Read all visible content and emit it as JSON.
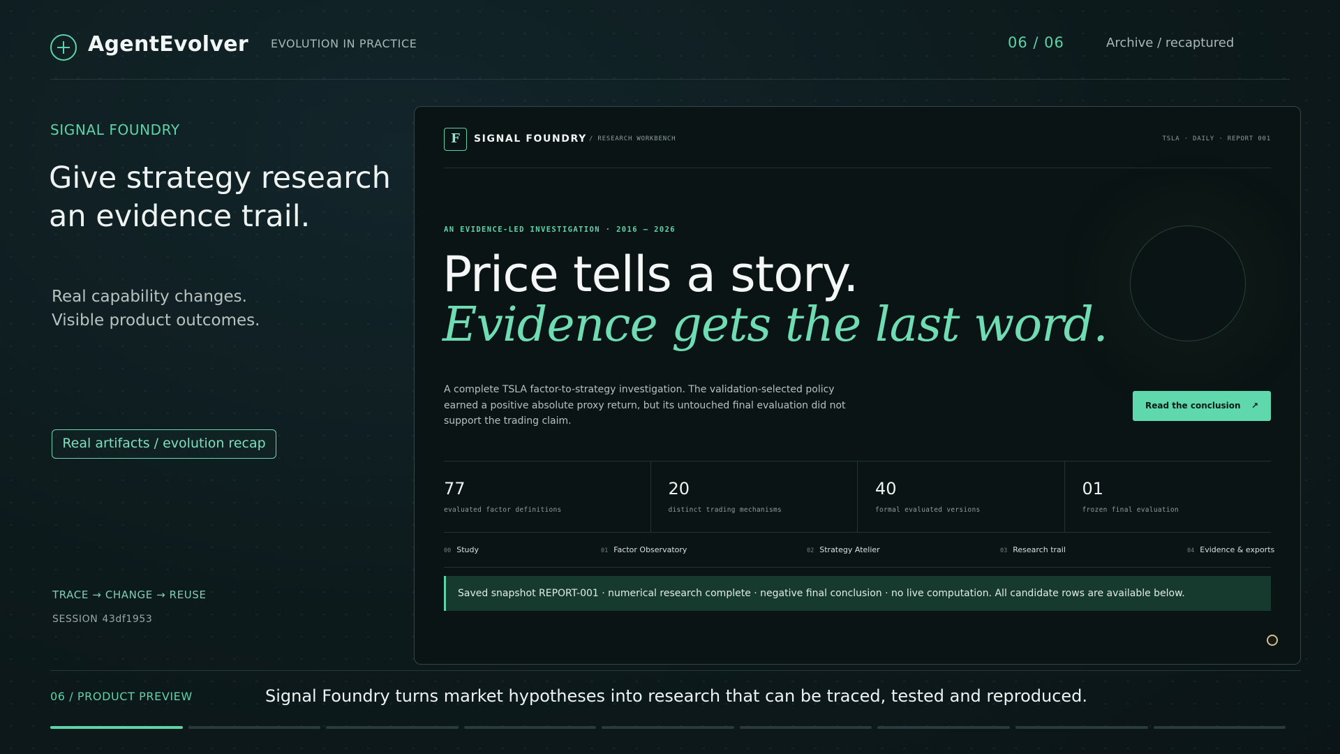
{
  "header": {
    "brand": "AgentEvolver",
    "tagline": "EVOLUTION IN PRACTICE",
    "counter": "06 / 06",
    "archive_link": "Archive / recaptured"
  },
  "left": {
    "eyebrow": "SIGNAL FOUNDRY",
    "headline_line1": "Give strategy research",
    "headline_line2": "an evidence trail.",
    "sub_line1": "Real capability changes.",
    "sub_line2": "Visible product outcomes.",
    "pill": "Real artifacts / evolution recap",
    "trace": "TRACE → CHANGE → REUSE",
    "session_label": "SESSION",
    "session_id": "43df1953"
  },
  "preview": {
    "logo_letter": "F",
    "brand": "SIGNAL FOUNDRY",
    "brand_sub": "/ RESEARCH WORKBENCH",
    "report_tag": "TSLA · DAILY · REPORT 001",
    "eyebrow": "AN EVIDENCE-LED INVESTIGATION · 2016 — 2026",
    "title_line1": "Price tells a story.",
    "title_line2": "Evidence gets the last word.",
    "description": "A complete TSLA factor-to-strategy investigation. The validation-selected policy earned a positive absolute proxy return, but its untouched final evaluation did not support the trading claim.",
    "cta_label": "Read the conclusion",
    "cta_arrow": "↗",
    "stats": [
      {
        "value": "77",
        "label": "evaluated factor definitions"
      },
      {
        "value": "20",
        "label": "distinct trading mechanisms"
      },
      {
        "value": "40",
        "label": "formal evaluated versions"
      },
      {
        "value": "01",
        "label": "frozen final evaluation"
      }
    ],
    "nav": [
      {
        "num": "00",
        "label": "Study"
      },
      {
        "num": "01",
        "label": "Factor Observatory"
      },
      {
        "num": "02",
        "label": "Strategy Atelier"
      },
      {
        "num": "03",
        "label": "Research trail"
      },
      {
        "num": "04",
        "label": "Evidence & exports"
      }
    ],
    "banner": "Saved snapshot REPORT-001 · numerical research complete · negative final conclusion · no live computation. All candidate rows are available below."
  },
  "footer": {
    "label": "06 / PRODUCT PREVIEW",
    "text": "Signal Foundry turns market hypotheses into research that can be traced, tested and reproduced.",
    "progress_segments": 9,
    "progress_active": 1
  },
  "colors": {
    "accent": "#5fd3a8",
    "background": "#0e1a1c",
    "banner": "#163a2d"
  }
}
